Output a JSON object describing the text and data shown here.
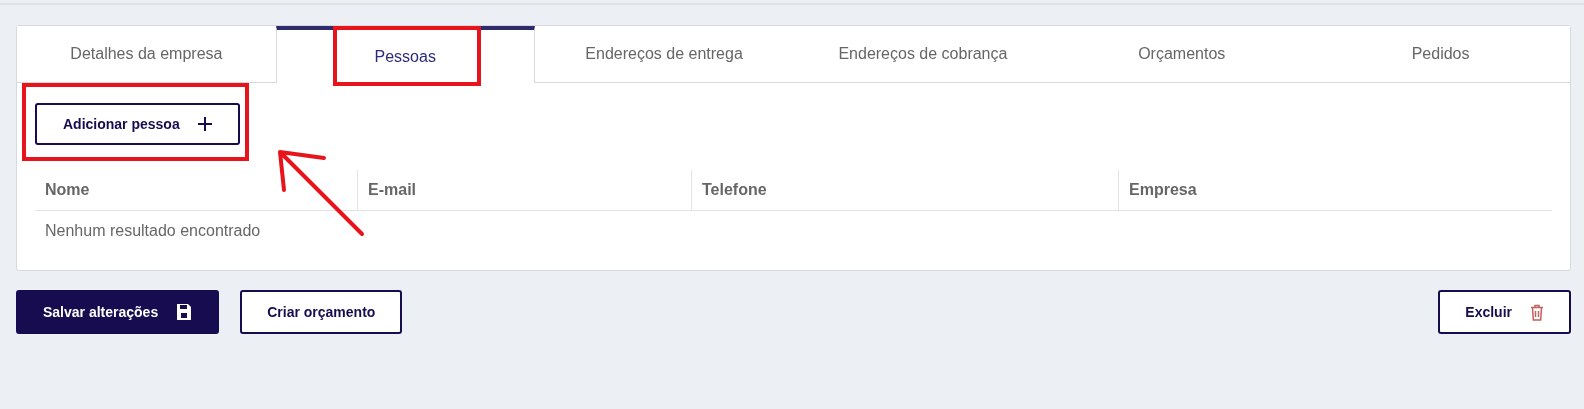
{
  "tabs": [
    {
      "label": "Detalhes da empresa",
      "selected": false,
      "highlighted": false
    },
    {
      "label": "Pessoas",
      "selected": true,
      "highlighted": true
    },
    {
      "label": "Endereços de entrega",
      "selected": false,
      "highlighted": false
    },
    {
      "label": "Endereços de cobrança",
      "selected": false,
      "highlighted": false
    },
    {
      "label": "Orçamentos",
      "selected": false,
      "highlighted": false
    },
    {
      "label": "Pedidos",
      "selected": false,
      "highlighted": false
    }
  ],
  "add_button": {
    "label": "Adicionar pessoa",
    "highlighted": true
  },
  "table": {
    "columns": [
      "Nome",
      "E-mail",
      "Telefone",
      "Empresa"
    ],
    "empty_message": "Nenhum resultado encontrado"
  },
  "actions": [
    {
      "label": "Salvar alterações",
      "kind": "save"
    },
    {
      "label": "Criar orçamento",
      "kind": "plain"
    },
    {
      "label": "Excluir",
      "kind": "delete"
    }
  ]
}
